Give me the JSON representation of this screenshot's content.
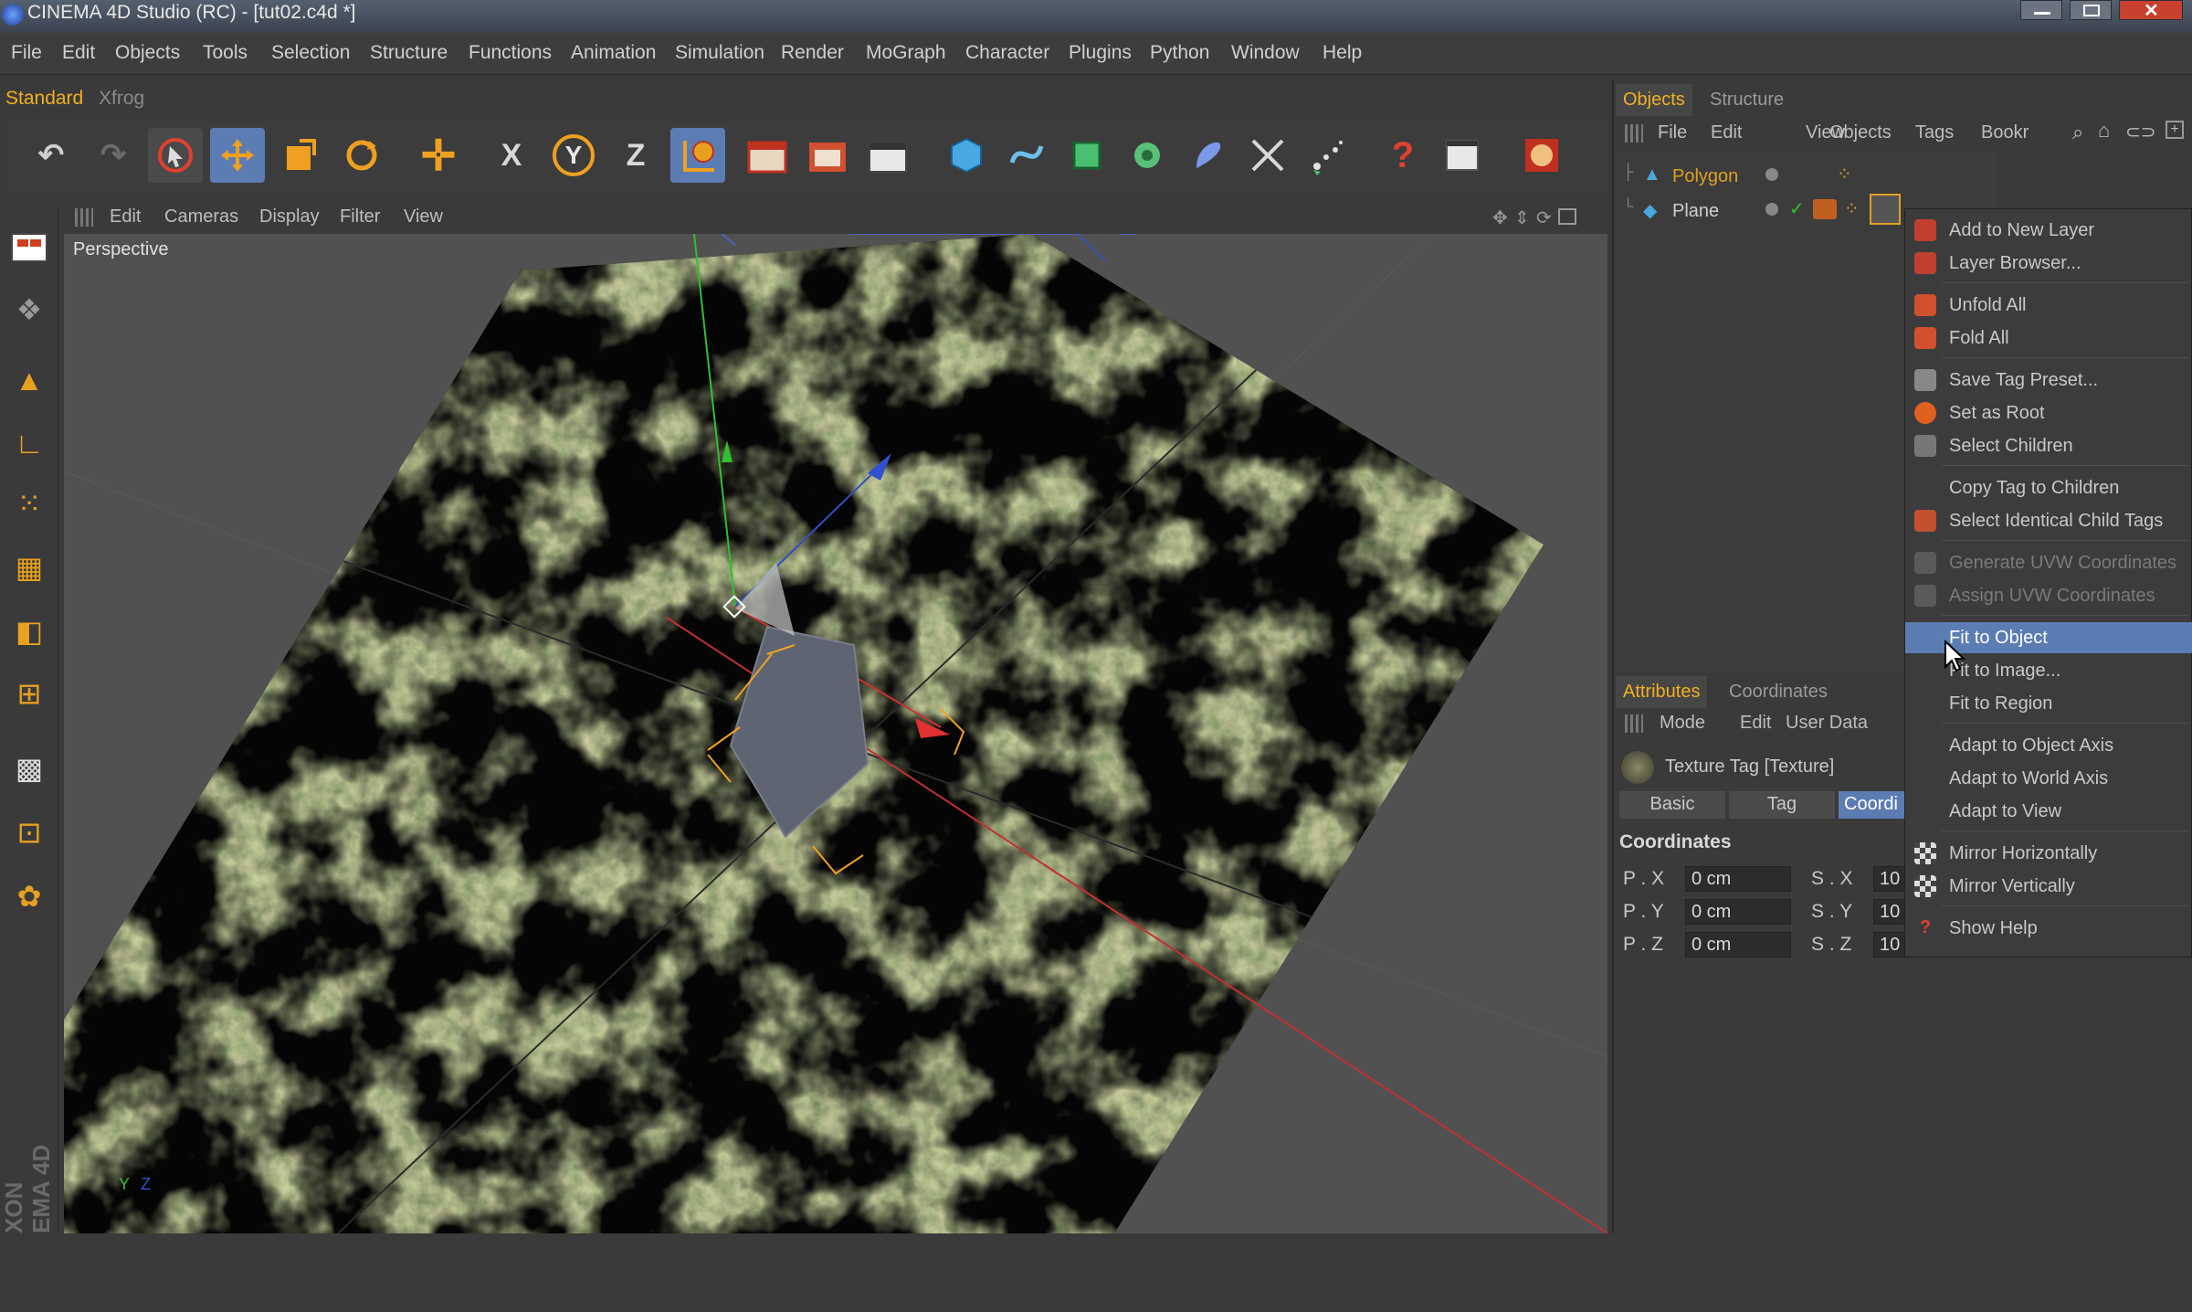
{
  "window": {
    "title": "CINEMA 4D Studio (RC) - [tut02.c4d *]"
  },
  "menubar": [
    "File",
    "Edit",
    "Objects",
    "Tools",
    "Selection",
    "Structure",
    "Functions",
    "Animation",
    "Simulation",
    "Render",
    "MoGraph",
    "Character",
    "Plugins",
    "Python",
    "Window",
    "Help"
  ],
  "layout_tabs": {
    "active": "Standard",
    "other": "Xfrog"
  },
  "toolbar": {
    "axis_x": "X",
    "axis_y": "Y",
    "axis_z": "Z",
    "help_glyph": "?"
  },
  "viewport": {
    "menu": [
      "Edit",
      "Cameras",
      "Display",
      "Filter",
      "View"
    ],
    "label": "Perspective",
    "axis_y": "Y",
    "axis_z": "Z",
    "watermark": "XON\nEMA 4D"
  },
  "objects_panel": {
    "tabs": [
      "Objects",
      "Structure"
    ],
    "menu": [
      "File",
      "Edit",
      "View",
      "Objects",
      "Tags",
      "Bookr"
    ],
    "items": [
      {
        "name": "Polygon",
        "color": "#e0a020"
      },
      {
        "name": "Plane",
        "color": "#cfcfcf"
      }
    ]
  },
  "context_menu": {
    "items": [
      {
        "label": "Add to New Layer",
        "disabled": false
      },
      {
        "label": "Layer Browser...",
        "disabled": false
      },
      {
        "label": "Unfold All",
        "disabled": false
      },
      {
        "label": "Fold All",
        "disabled": false
      },
      {
        "label": "Save Tag Preset...",
        "disabled": false
      },
      {
        "label": "Set as Root",
        "disabled": false
      },
      {
        "label": "Select Children",
        "disabled": false
      },
      {
        "label": "Copy Tag to Children",
        "disabled": false
      },
      {
        "label": "Select Identical Child Tags",
        "disabled": false
      },
      {
        "label": "Generate UVW Coordinates",
        "disabled": true
      },
      {
        "label": "Assign UVW Coordinates",
        "disabled": true
      },
      {
        "label": "Fit to Object",
        "disabled": false,
        "highlighted": true
      },
      {
        "label": "Fit to Image...",
        "disabled": false
      },
      {
        "label": "Fit to Region",
        "disabled": false
      },
      {
        "label": "Adapt to Object Axis",
        "disabled": false
      },
      {
        "label": "Adapt to World Axis",
        "disabled": false
      },
      {
        "label": "Adapt to View",
        "disabled": false
      },
      {
        "label": "Mirror Horizontally",
        "disabled": false
      },
      {
        "label": "Mirror Vertically",
        "disabled": false
      },
      {
        "label": "Show Help",
        "disabled": false
      }
    ]
  },
  "attributes_panel": {
    "tabs": [
      "Attributes",
      "Coordinates"
    ],
    "menu": [
      "Mode",
      "Edit",
      "User Data"
    ],
    "header": "Texture Tag [Texture]",
    "subtabs": [
      "Basic",
      "Tag",
      "Coordi"
    ],
    "section": "Coordinates",
    "rows": [
      {
        "p": "P . X",
        "pval": "0 cm",
        "s": "S . X",
        "sval": "10"
      },
      {
        "p": "P . Y",
        "pval": "0 cm",
        "s": "S . Y",
        "sval": "10"
      },
      {
        "p": "P . Z",
        "pval": "0 cm",
        "s": "S . Z",
        "sval": "10"
      }
    ]
  },
  "colors": {
    "accent": "#e8a020",
    "highlight": "#5b7db3",
    "active_tab": "#f0b020"
  }
}
